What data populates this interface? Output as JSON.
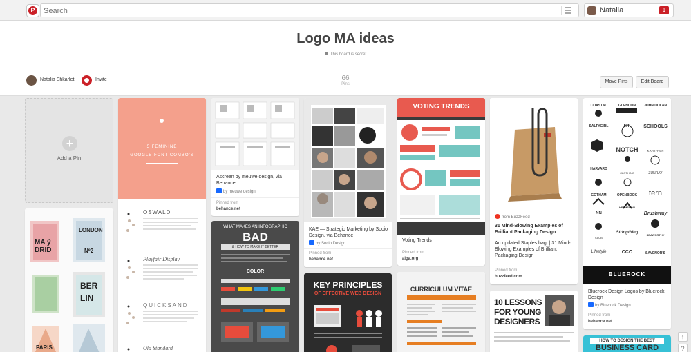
{
  "topbar": {
    "search_placeholder": "Search",
    "user_name": "Natalia",
    "notification_count": "1"
  },
  "board": {
    "title": "Logo MA ideas",
    "secret_note": "This board is secret",
    "owner_name": "Natalia Shkarlet",
    "invite_label": "Invite",
    "pin_count": "66",
    "pin_count_label": "Pins",
    "move_pins_label": "Move Pins",
    "edit_board_label": "Edit Board"
  },
  "add_pin_label": "Add a Pin",
  "pins": {
    "ascreen": {
      "description": "Ascreen by meuwe design, via Behance",
      "source_line": "by meuwe design",
      "pinned_from_label": "Pinned from",
      "pinned_from": "behance.net"
    },
    "kae": {
      "description": "KAE — Strategic Marketing by Socio Design, via Behance",
      "source_line": "by Socio Design",
      "pinned_from_label": "Pinned from",
      "pinned_from": "behance.net"
    },
    "voting": {
      "image_heading": "VOTING TRENDS",
      "description": "Voting Trends",
      "pinned_from_label": "Pinned from",
      "pinned_from": "aiga.org"
    },
    "buzzfeed": {
      "source_line": "from BuzzFeed",
      "title": "31 Mind-Blowing Examples of Brilliant Packaging Design",
      "description": "An updated Staples bag. | 31 Mind-Blowing Examples of Brilliant Packaging Design",
      "pinned_from_label": "Pinned from",
      "pinned_from": "buzzfeed.com"
    },
    "bluerock": {
      "description": "Bluerock Design Logos by Bluerock Design",
      "source_line": "by Bluerock Design",
      "pinned_from_label": "Pinned from",
      "pinned_from": "behance.net"
    },
    "google_fonts": {
      "heading_line1": "5 FEMININE",
      "heading_line2": "GOOGLE FONT COMBO'S",
      "font1": "OSWALD",
      "font2": "Playfair Display",
      "font3": "QUICKSAND",
      "font4": "Old Standard"
    },
    "infographic": {
      "heading": "WHAT MAKES AN INFOGRAPHIC",
      "big_word": "BAD",
      "sub": "& HOW TO MAKE IT BETTER",
      "section": "COLOR"
    },
    "web_design": {
      "line1": "KEY PRINCIPLES",
      "line2": "OF EFFECTIVE WEB DESIGN"
    },
    "cv": {
      "heading": "CURRICULUM VITAE"
    },
    "lessons": {
      "line1": "10 LESSONS",
      "line2": "FOR YOUNG",
      "line3": "DESIGNERS"
    },
    "business_card": {
      "line1": "HOW TO DESIGN THE BEST",
      "line2": "BUSINESS CARD"
    }
  },
  "logo_grid": [
    "COASTAL",
    "GLENDON",
    "JOHN DOLAN",
    "SALTYGIRL",
    "H/F",
    "SCHOOLS",
    "SALT",
    "NOTCH",
    "K.KRYFFICH",
    "HARVARD",
    "CLOTHING",
    "ZUNRAY",
    "GOTHAM",
    "OPENBOOK",
    "tern",
    "NN",
    "HELMSMAN",
    "Brushway",
    "CLUB",
    "Stringthing",
    "SEAWORTHY",
    "Lifestyle",
    "CCO",
    "SAVENOR'S"
  ],
  "logo_grid_banner": "BLUEROCK",
  "colors": {
    "pinterest_red": "#cb2027",
    "background": "#e9e9e9",
    "salmon": "#f4a08c",
    "voting_red": "#e85a4f"
  }
}
